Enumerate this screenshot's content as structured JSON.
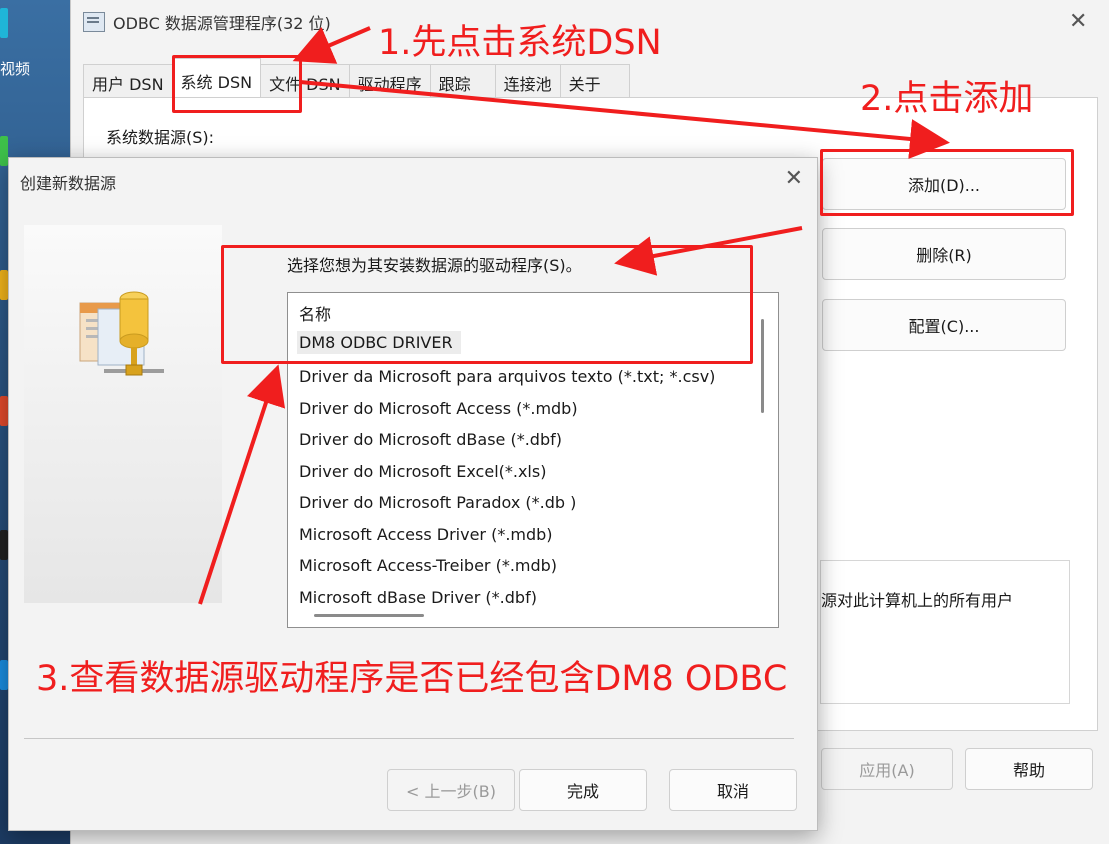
{
  "desktop": {
    "label": "视频"
  },
  "odbc": {
    "title": "ODBC 数据源管理程序(32 位)",
    "tabs": [
      "用户 DSN",
      "系统 DSN",
      "文件 DSN",
      "驱动程序",
      "跟踪",
      "连接池",
      "关于"
    ],
    "system_data_sources_label": "系统数据源(S):",
    "buttons": {
      "add": "添加(D)...",
      "remove": "删除(R)",
      "configure": "配置(C)...",
      "apply": "应用(A)",
      "help": "帮助"
    },
    "info_text": "源对此计算机上的所有用户"
  },
  "create_dialog": {
    "title": "创建新数据源",
    "prompt": "选择您想为其安装数据源的驱动程序(S)。",
    "list_header": "名称",
    "drivers": [
      "DM8 ODBC DRIVER",
      "Driver da Microsoft para arquivos texto (*.txt; *.csv)",
      "Driver do Microsoft Access (*.mdb)",
      "Driver do Microsoft dBase (*.dbf)",
      "Driver do Microsoft Excel(*.xls)",
      "Driver do Microsoft Paradox (*.db )",
      "Microsoft Access Driver (*.mdb)",
      "Microsoft Access-Treiber (*.mdb)",
      "Microsoft dBase Driver (*.dbf)"
    ],
    "selected_index": 0,
    "buttons": {
      "back": "< 上一步(B)",
      "finish": "完成",
      "cancel": "取消"
    }
  },
  "annotations": {
    "step1": "1.先点击系统DSN",
    "step2": "2.点击添加",
    "step3": "3.查看数据源驱动程序是否已经包含DM8 ODBC",
    "color": "#f01e1e"
  }
}
